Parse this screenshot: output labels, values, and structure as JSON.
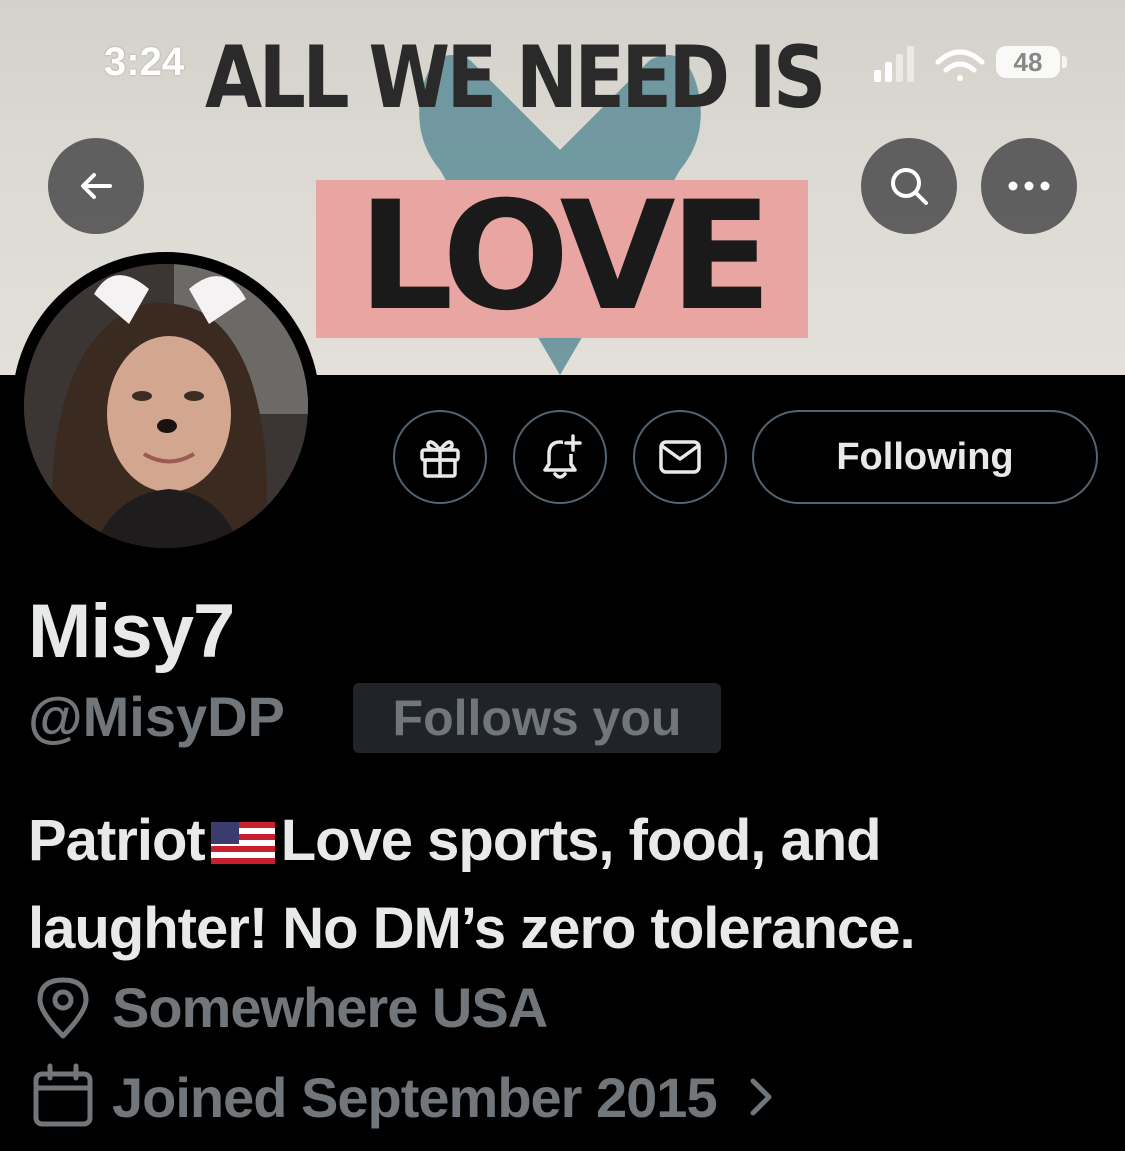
{
  "status_bar": {
    "time": "3:24",
    "battery": "48"
  },
  "banner": {
    "line1": "ALL WE NEED IS",
    "line2": "LOVE"
  },
  "nav": {
    "back_icon": "arrow-left-icon",
    "search_icon": "search-icon",
    "more_icon": "more-horizontal-icon"
  },
  "actions": {
    "gift_icon": "gift-icon",
    "bell_icon": "bell-plus-icon",
    "mail_icon": "mail-icon",
    "following_label": "Following"
  },
  "profile": {
    "display_name": "Misy7",
    "handle": "@MisyDP",
    "follows_you": "Follows you",
    "bio_part1": "Patriot",
    "bio_part2": "Love sports, food, and laughter! No DM’s zero tolerance.",
    "location": "Somewhere USA",
    "joined": "Joined September 2015"
  },
  "colors": {
    "background": "#000000",
    "primary_text": "#e7e9ea",
    "secondary_text": "#71767b",
    "border": "#536471",
    "badge_bg": "#202327"
  }
}
